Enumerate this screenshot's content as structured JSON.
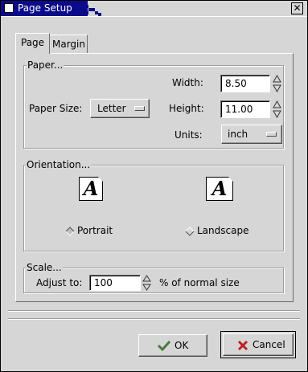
{
  "window": {
    "title": "Page Setup",
    "close_glyph": "✕"
  },
  "tabs": [
    {
      "label": "Page",
      "active": true
    },
    {
      "label": "Margin",
      "active": false
    }
  ],
  "paper": {
    "frame_label": "Paper...",
    "size_label": "Paper Size:",
    "size_value": "Letter",
    "width_label": "Width:",
    "width_value": "8.50",
    "height_label": "Height:",
    "height_value": "11.00",
    "units_label": "Units:",
    "units_value": "inch"
  },
  "orientation": {
    "frame_label": "Orientation...",
    "icon_letter": "A",
    "options": [
      {
        "label": "Portrait",
        "selected": true
      },
      {
        "label": "Landscape",
        "selected": false
      }
    ]
  },
  "scale": {
    "frame_label": "Scale...",
    "adjust_label": "Adjust to:",
    "value": "100",
    "suffix": "% of normal size"
  },
  "buttons": {
    "ok": "OK",
    "cancel": "Cancel"
  },
  "icons": {
    "spin": "spin-arrows-icon",
    "ok": "check-icon",
    "cancel": "cross-icon"
  },
  "colors": {
    "titlebar": "#0a0a8a",
    "background": "#d6d6d6",
    "cancel_x": "#c02020",
    "ok_check": "#4a7a3a"
  }
}
